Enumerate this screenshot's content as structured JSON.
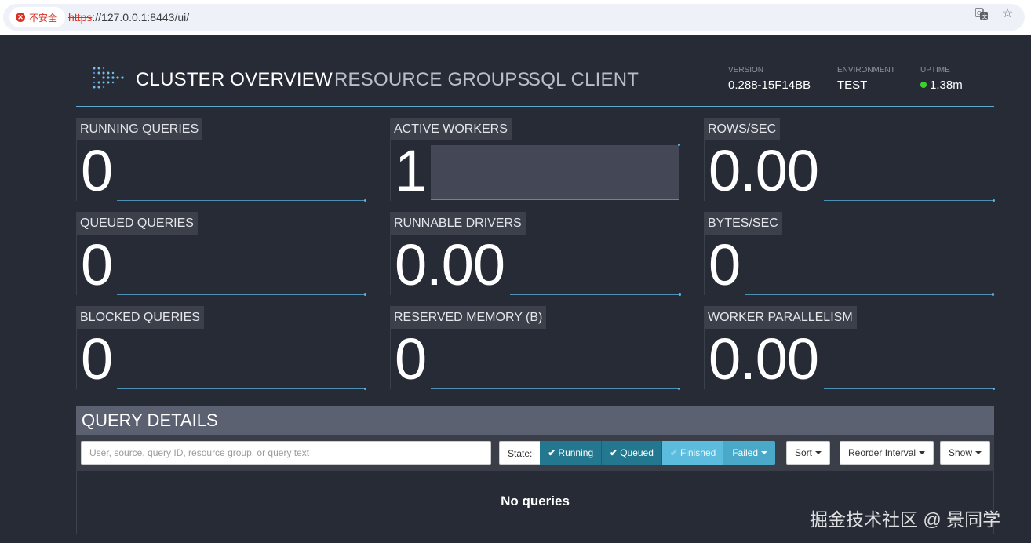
{
  "browser": {
    "security_label": "不安全",
    "url_protocol": "https",
    "url_rest": "://127.0.0.1:8443/ui/"
  },
  "nav": {
    "cluster_overview": "CLUSTER OVERVIEW",
    "resource_groups": "RESOURCE GROUPS",
    "sql_client": "SQL CLIENT"
  },
  "header_info": {
    "version_label": "VERSION",
    "version_value": "0.288-15F14BB",
    "environment_label": "ENVIRONMENT",
    "environment_value": "TEST",
    "uptime_label": "UPTIME",
    "uptime_value": "1.38m"
  },
  "tiles": {
    "running_queries": {
      "label": "RUNNING QUERIES",
      "value": "0"
    },
    "active_workers": {
      "label": "ACTIVE WORKERS",
      "value": "1"
    },
    "rows_sec": {
      "label": "ROWS/SEC",
      "value": "0.00"
    },
    "queued_queries": {
      "label": "QUEUED QUERIES",
      "value": "0"
    },
    "runnable_drivers": {
      "label": "RUNNABLE DRIVERS",
      "value": "0.00"
    },
    "bytes_sec": {
      "label": "BYTES/SEC",
      "value": "0"
    },
    "blocked_queries": {
      "label": "BLOCKED QUERIES",
      "value": "0"
    },
    "reserved_memory": {
      "label": "RESERVED MEMORY (B)",
      "value": "0"
    },
    "worker_parallelism": {
      "label": "WORKER PARALLELISM",
      "value": "0.00"
    }
  },
  "query_details": {
    "title": "QUERY DETAILS",
    "search_placeholder": "User, source, query ID, resource group, or query text",
    "state_label": "State:",
    "state_running": "Running",
    "state_queued": "Queued",
    "state_finished": "Finished",
    "state_failed": "Failed",
    "sort_label": "Sort",
    "reorder_label": "Reorder Interval",
    "show_label": "Show",
    "empty_message": "No queries"
  },
  "watermark": "掘金技术社区 @ 景同学",
  "colors": {
    "background": "#262b36",
    "accent": "#5fa8cf",
    "state_active": "#23788f",
    "state_inactive": "#5cbcde",
    "uptime_ok": "#35d629"
  }
}
